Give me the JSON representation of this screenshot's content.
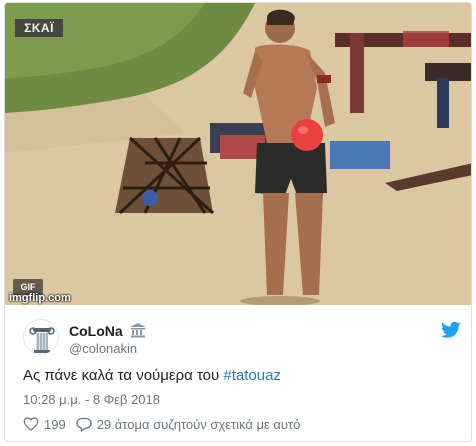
{
  "media": {
    "channel_logo": "ΣΚΑΪ",
    "gif_badge": "GIF",
    "watermark": "imgflip.com",
    "description_icon": "video-still"
  },
  "tweet": {
    "display_name": "CoLoNa",
    "name_emoji": "classical-building-emoji",
    "handle": "@colonakin",
    "text_prefix": "Ας πάνε καλά τα νούμερα του ",
    "hashtag": "#tatouaz",
    "timestamp": "10:28 μ.μ. - 8 Φεβ 2018",
    "likes": "199",
    "replies_text": "29 άτομα συζητούν σχετικά με αυτό"
  },
  "colors": {
    "twitter_blue": "#1da1f2",
    "link": "#2b7bb9",
    "muted": "#697882",
    "sand": "#dcc7a3"
  }
}
